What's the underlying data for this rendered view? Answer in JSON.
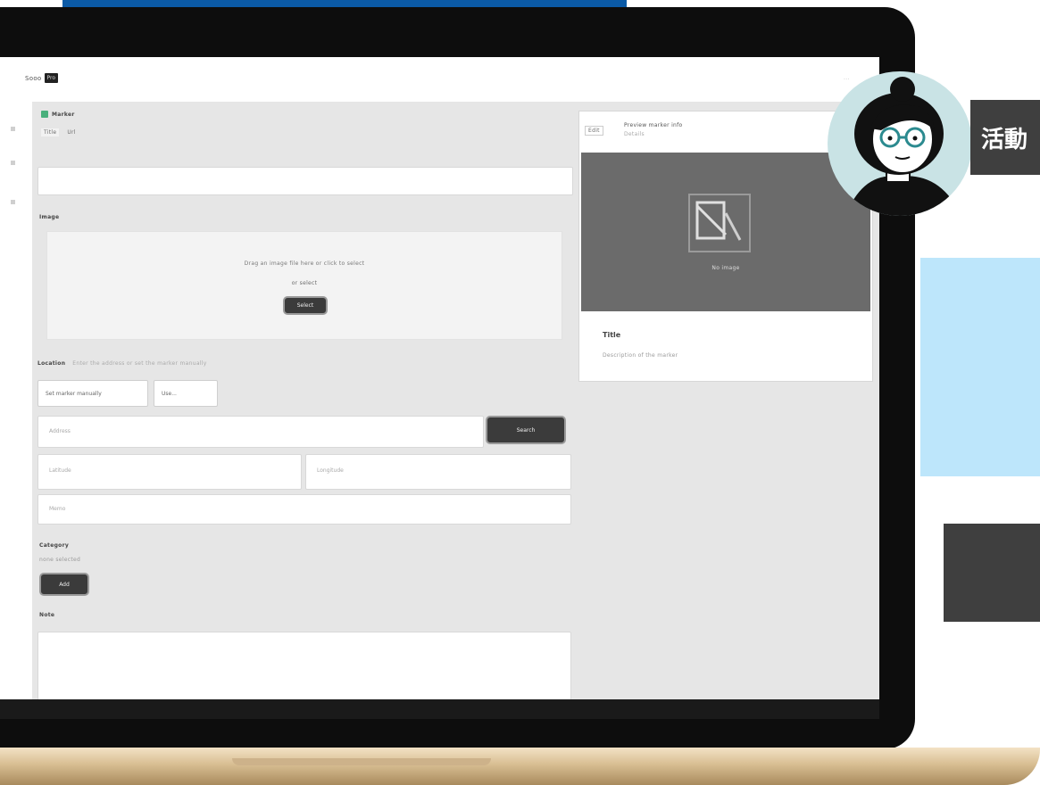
{
  "colors": {
    "banner_blue": "#0b5aa6",
    "bezel": "#0d0d0d",
    "panel_grey": "#e6e6e6",
    "dark_button": "#3b3b3b",
    "overlay_label_bg": "#3f3f3f",
    "overlay_card_blue": "#bde6fb",
    "avatar_bg": "#c9e3e5"
  },
  "app": {
    "header": {
      "logo_text": "Sooo",
      "logo_badge": "Pro",
      "corner_text": "..."
    },
    "left_rail": {
      "icons": [
        "grid-icon",
        "list-icon",
        "settings-icon"
      ]
    },
    "form": {
      "title_badge": "Marker",
      "section_tags": [
        "Title",
        "Url"
      ],
      "title_input_placeholder": "",
      "image_section_label": "Image",
      "upload_hint": "Drag an image file here or click to select",
      "upload_or": "or select",
      "upload_button": "Select",
      "location_label": "Location",
      "location_hint": "Enter the address or set the marker manually",
      "location_options": [
        "Set marker manually",
        "Use..."
      ],
      "address_placeholder": "Address",
      "search_button": "Search",
      "latitude_placeholder": "Latitude",
      "longitude_placeholder": "Longitude",
      "extra_placeholder": "Memo",
      "category_label": "Category",
      "category_sub": "none selected",
      "category_button": "Add",
      "note_label": "Note"
    },
    "preview": {
      "badge": "Edit",
      "header_line1": "Preview marker info",
      "header_line2": "Details",
      "image_caption": "No image",
      "title": "Title",
      "description": "Description of the marker"
    }
  },
  "overlay": {
    "label": "活動",
    "avatar_name": "guide-avatar"
  }
}
